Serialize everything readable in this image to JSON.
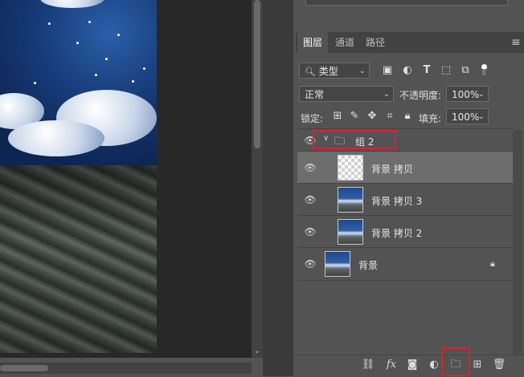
{
  "layers_panel": {
    "tabs": [
      {
        "label": "图层"
      },
      {
        "label": "通道"
      },
      {
        "label": "路径"
      }
    ],
    "filter_kind": "类型",
    "blend_mode": "正常",
    "opacity_label": "不透明度:",
    "opacity_value": "100%",
    "lock_label": "锁定:",
    "fill_label": "填充:",
    "fill_value": "100%",
    "layers": [
      {
        "name": "组 2"
      },
      {
        "name": "背景 拷贝"
      },
      {
        "name": "背景 拷贝 3"
      },
      {
        "name": "背景 拷贝 2"
      },
      {
        "name": "背景"
      }
    ]
  },
  "icons": {
    "filter_search": "search-icon",
    "image_filter": "image-icon",
    "adjust_filter": "circle-half-icon",
    "type_filter": "text-icon",
    "shape_filter": "shape-icon",
    "smart_filter": "smart-object-icon",
    "toggle": "toggle-icon",
    "lock_pixels": "checker-icon",
    "lock_brush": "brush-icon",
    "lock_move": "move-icon",
    "lock_artboard": "artboard-icon",
    "lock_all": "lock-icon",
    "link": "link-icon",
    "fx": "fx-icon",
    "mask": "mask-icon",
    "adjustment": "adjustment-icon",
    "new_group": "folder-icon",
    "new_layer": "new-layer-icon",
    "delete": "trash-icon"
  },
  "colors": {
    "panel_bg": "#535353",
    "selected_row": "#6d6d6d",
    "highlight_box": "#e0202a"
  }
}
